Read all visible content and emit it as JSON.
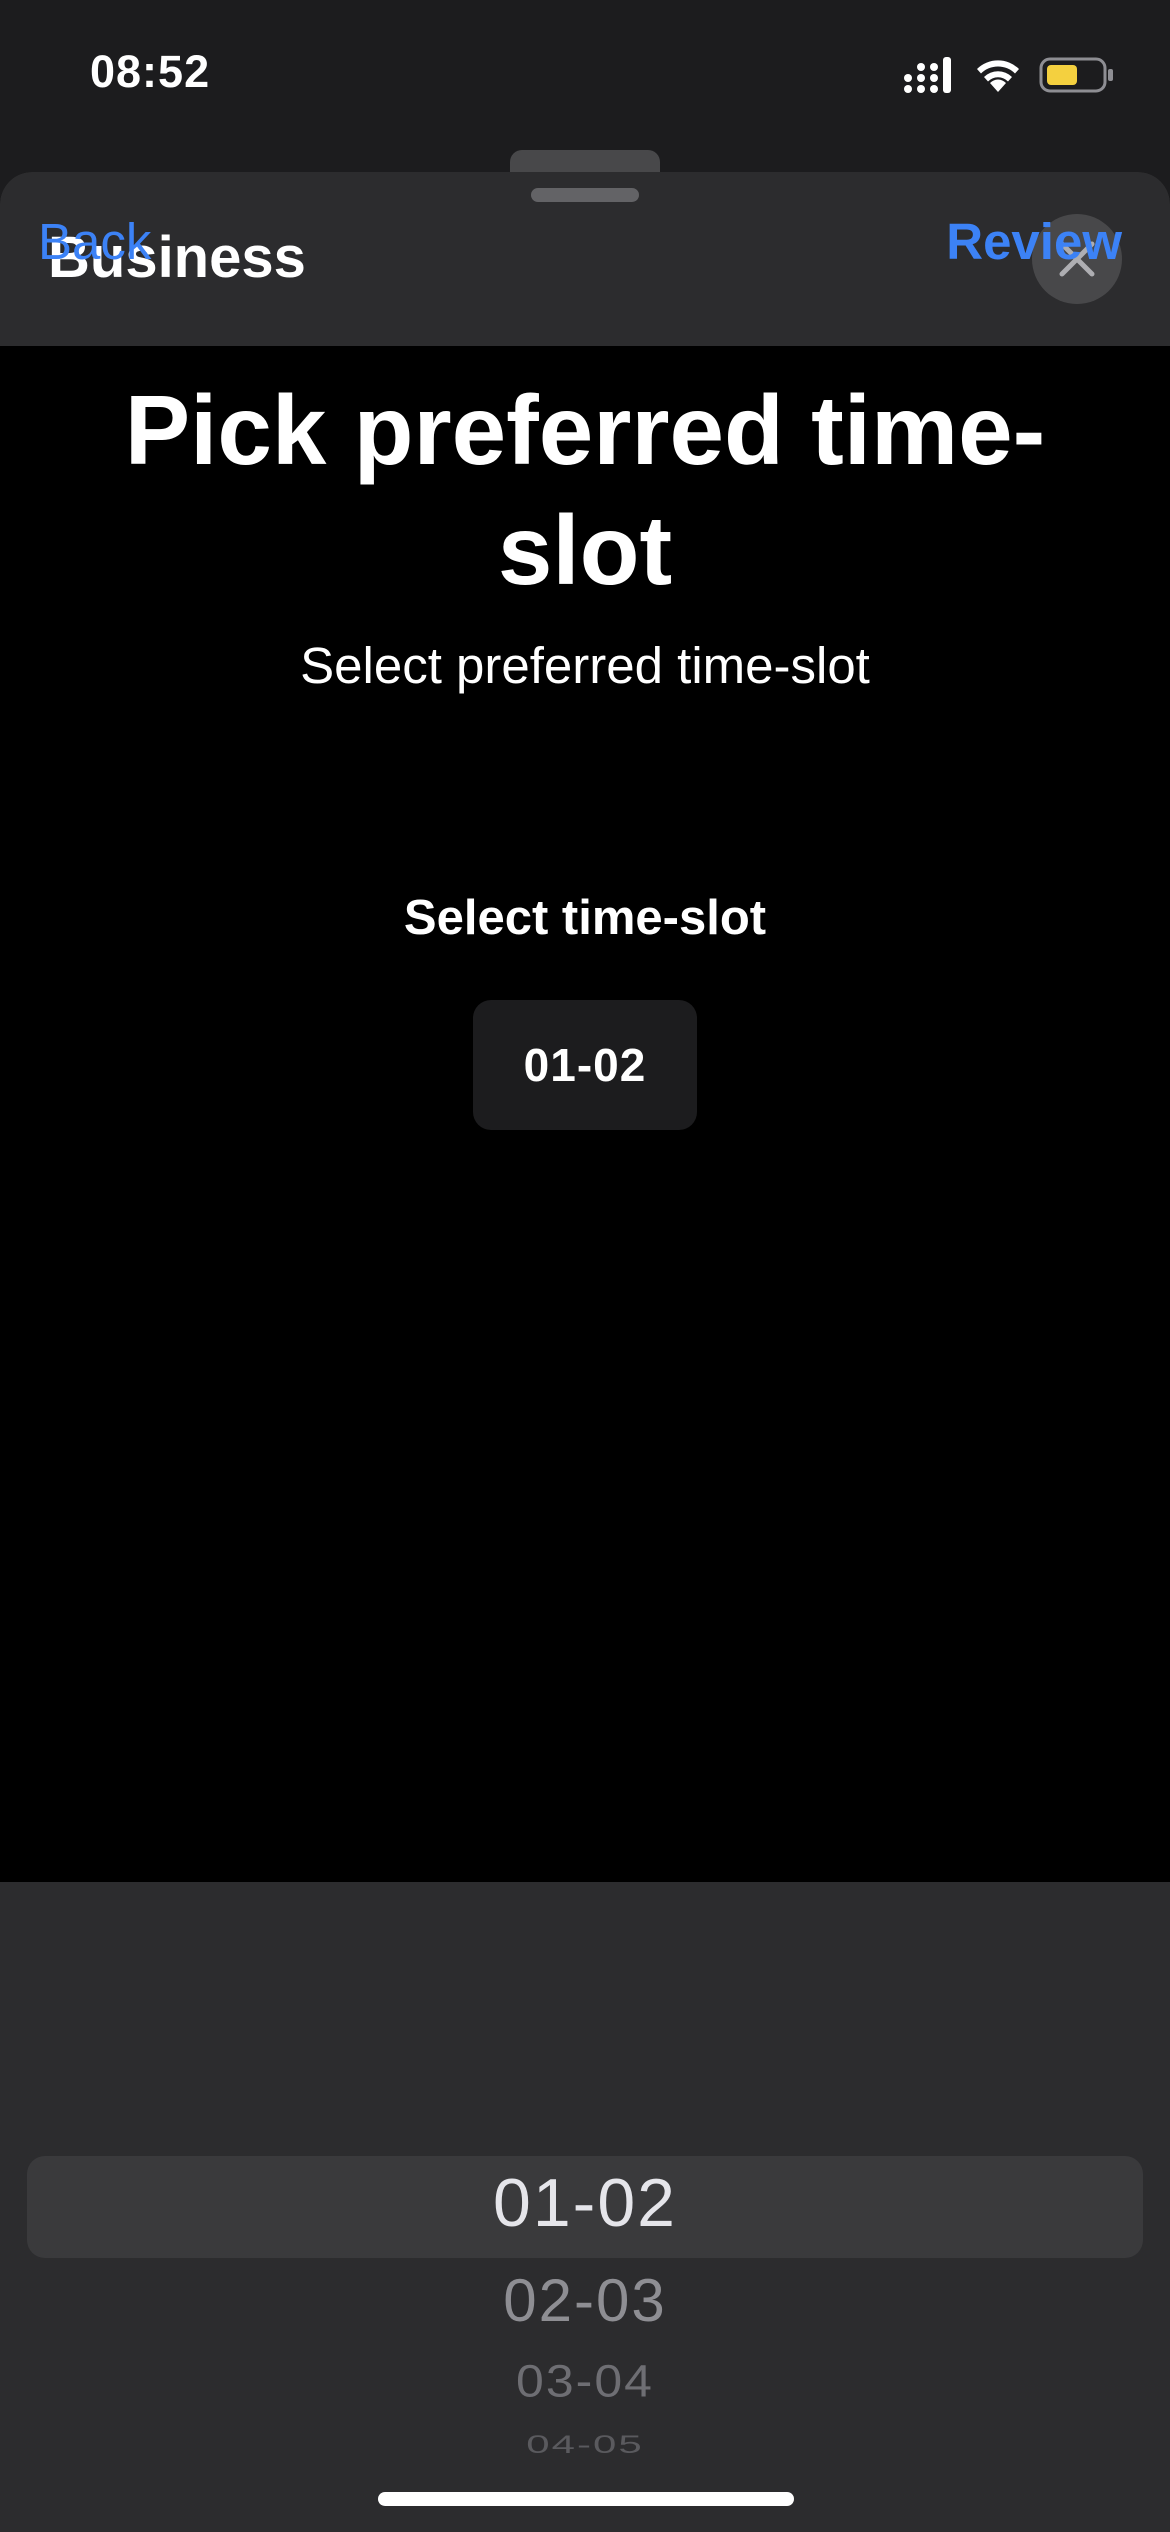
{
  "status_bar": {
    "time": "08:52",
    "icons": [
      "cellular-signal-icon",
      "wifi-icon",
      "battery-icon"
    ],
    "battery_color": "#f4d03f"
  },
  "sheet": {
    "title": "Business",
    "close_icon": "close-icon"
  },
  "nav": {
    "back_label": "Back",
    "review_label": "Review"
  },
  "content": {
    "heading": "Pick preferred time-slot",
    "subheading": "Select preferred time-slot",
    "field_label": "Select time-slot",
    "selected_value": "01-02"
  },
  "picker": {
    "options": [
      "01-02",
      "02-03",
      "03-04",
      "04-05"
    ],
    "selected": "01-02"
  },
  "colors": {
    "accent": "#3c82f6",
    "background": "#000000",
    "sheet_header": "#2c2c2e"
  }
}
